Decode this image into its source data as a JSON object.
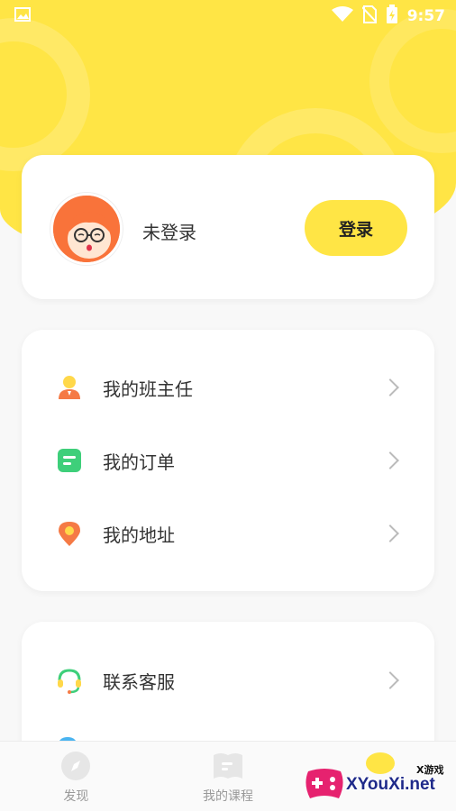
{
  "status_bar": {
    "time": "9:57"
  },
  "profile": {
    "name": "未登录",
    "login_label": "登录"
  },
  "menu_group_1": [
    {
      "label": "我的班主任",
      "icon": "teacher-icon"
    },
    {
      "label": "我的订单",
      "icon": "order-icon"
    },
    {
      "label": "我的地址",
      "icon": "location-icon"
    }
  ],
  "menu_group_2": [
    {
      "label": "联系客服",
      "icon": "headset-icon"
    }
  ],
  "tabbar": {
    "tabs": [
      {
        "label": "发现",
        "icon": "compass-icon"
      },
      {
        "label": "我的课程",
        "icon": "book-icon"
      }
    ]
  },
  "watermark": {
    "text": "XYouXi.net",
    "small": "X游戏"
  },
  "colors": {
    "brand_yellow": "#ffe545",
    "avatar_orange": "#f9733a",
    "order_green": "#3ecf7a",
    "location_orange": "#f57a45"
  }
}
